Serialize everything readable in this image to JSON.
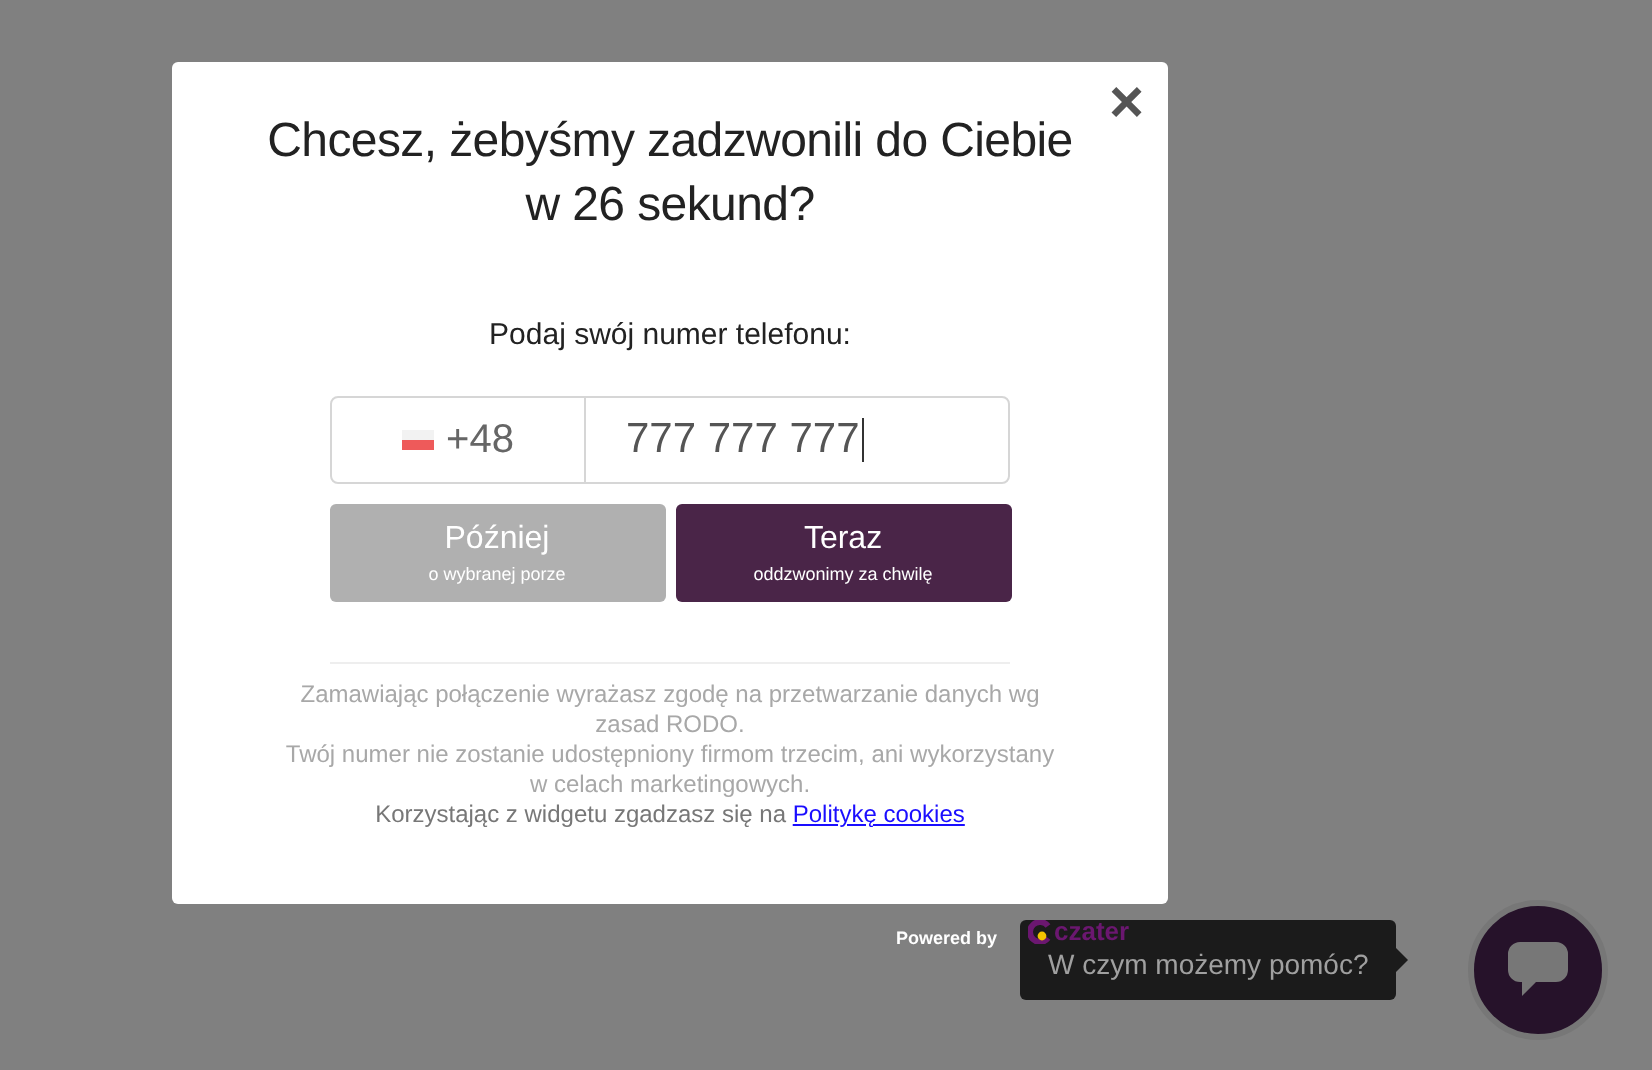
{
  "dialog": {
    "title": "Chcesz, żebyśmy zadzwonili do Ciebie w 26 sekund?",
    "close": "×",
    "prompt": "Podaj swój numer telefonu:",
    "phone": {
      "country_code": "+48",
      "value": "777 777 777"
    },
    "buttons": [
      {
        "label": "Później",
        "sublabel": "o wybranej porze",
        "kind": "secondary"
      },
      {
        "label": "Teraz",
        "sublabel": "oddzwonimy za chwilę",
        "kind": "primary"
      }
    ],
    "consent": [
      "Zamawiając połączenie wyrażasz zgodę na przetwarzanie danych wg zasad RODO.",
      "Twój numer nie zostanie udostępniony firmom trzecim, ani wykorzystany w celach marketingowych."
    ],
    "cookies": {
      "text": "Korzystając z widgetu zgadzasz się na",
      "link": "Politykę cookies"
    }
  },
  "footer": {
    "powered_by": "Powered by",
    "brand": "czater"
  },
  "chat": {
    "tooltip": "W czym możemy pomóc?"
  }
}
